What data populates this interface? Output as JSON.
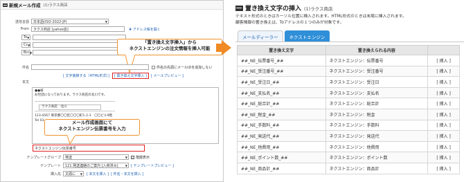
{
  "left": {
    "title": "新規メール作成",
    "shop": "(1)ラクス商店",
    "fields": {
      "charset_label": "送信言語",
      "charset_value": "日本語(ISO-2022-JP)",
      "from_label": "From",
      "from_value": "ラクス商店 [yahoo店]",
      "to_label": "To",
      "cc_label": "Cc",
      "bcc_label": "Bcc",
      "address_link": "アドレス帳を開く",
      "subject_label": "件名",
      "subject_checkbox": "件名の先頭にメールIDを追加しない",
      "body_label": "本文"
    },
    "toolbar": {
      "convert_link": "[ 文字装飾する（HTML形式）]",
      "insert_link": "[ 置き換え文字挿入 ]",
      "preview_link": "[ メールプレビュー ]"
    },
    "body_lines": [
      "●●様",
      "お世話になっております。ラクス商店の北川です。",
      "ラクス商店　北川",
      "123-4567 東京都〇〇区〇〇〇町1-2-3　〇〇ビル9階",
      "Tel 03-xxxx-xxxx"
    ],
    "inserted_value": "ネクストエンジン伝票番号",
    "template_group_label": "テンプレートグループ",
    "template_group_value": "発送",
    "template_group_check": "階層表示",
    "template_label": "テンプレート",
    "template_value": "121.発送連絡のご案内 [入荷済み]",
    "template_preview": "[ テンプレートプレビュー ]",
    "insert_pos_label": "挿入先",
    "insert_pos_value": "文頭に",
    "insert_body_link": "[ 本文を挿入 ]",
    "insert_subject_link": "[ 件名・本文を挿入 ]",
    "callout_top": [
      "「置き換え文字挿入」から",
      "ネクストエンジンの注文情報を挿入可能"
    ],
    "callout_bottom": [
      "メール作成画面にて",
      "ネクストエンジン伝票番号を入力"
    ]
  },
  "right": {
    "title": "置き換え文字の挿入",
    "shop": "(1)ラクス商店",
    "desc1": "テキスト形式のときはカーソル位置に挿入されます。HTML形式のときは末尾に挿入されます。",
    "desc2": "顧客情報の置き換えは、Toアドレスの１つのみが対象です。",
    "tabs": [
      "メールディーラー",
      "ネクストエンジン"
    ],
    "headers": [
      "置き換え文字",
      "置き換えられる内容",
      ""
    ],
    "rows": [
      [
        "##_NE_伝票番号_##",
        "ネクストエンジン：伝票番号",
        "[ 挿入 ]"
      ],
      [
        "##_NE_受注番号_##",
        "ネクストエンジン：受注番号",
        "[ 挿入 ]"
      ],
      [
        "##_NE_受注日_##",
        "ネクストエンジン：受注日",
        "[ 挿入 ]"
      ],
      [
        "##_NE_支払名_##",
        "ネクストエンジン：支払名",
        "[ 挿入 ]"
      ],
      [
        "##_NE_総合計_##",
        "ネクストエンジン：総合計",
        "[ 挿入 ]"
      ],
      [
        "##_NE_税金_##",
        "ネクストエンジン：税金",
        "[ 挿入 ]"
      ],
      [
        "##_NE_手数料_##",
        "ネクストエンジン：手数料",
        "[ 挿入 ]"
      ],
      [
        "##_NE_発送代_##",
        "ネクストエンジン：発送代",
        "[ 挿入 ]"
      ],
      [
        "##_NE_他費用_##",
        "ネクストエンジン：他費用",
        "[ 挿入 ]"
      ],
      [
        "##_NE_ポイント数_##",
        "ネクストエンジン：ポイント数",
        "[ 挿入 ]"
      ],
      [
        "##_NE_商品計_##",
        "ネクストエンジン：商品計",
        "[ 挿入 ]"
      ]
    ]
  },
  "colors": {
    "accent_orange": "#f08a24",
    "highlight_red": "#e02020",
    "tab_active": "#2f8fd8",
    "link": "#1a5fb4"
  }
}
